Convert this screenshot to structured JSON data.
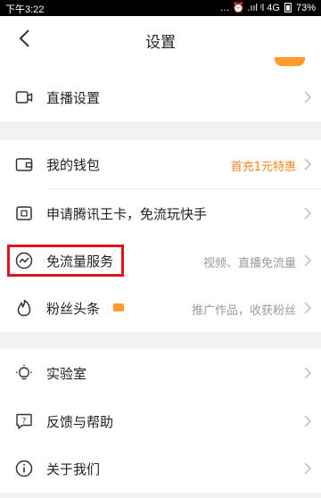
{
  "status_bar": {
    "time": "下午3:22",
    "indicators": "… ⏰ .ııl ᵎl 4G",
    "battery": "73%"
  },
  "nav": {
    "title": "设置"
  },
  "sections": [
    {
      "items": [
        {
          "id": "live",
          "label": "直播设置",
          "value": "",
          "icon": "video-camera-icon"
        }
      ]
    },
    {
      "items": [
        {
          "id": "wallet",
          "label": "我的钱包",
          "value": "首充1元特惠",
          "value_color": "#ff7f1f",
          "icon": "wallet-icon"
        },
        {
          "id": "tencent_card",
          "label": "申请腾讯王卡，免流玩快手",
          "value": "",
          "icon": "sim-card-icon"
        },
        {
          "id": "free_data",
          "label": "免流量服务",
          "value": "视频、直播免流量",
          "icon": "trend-line-icon",
          "highlighted": true
        },
        {
          "id": "fans_headline",
          "label": "粉丝头条",
          "value": "推广作品，收获粉丝",
          "icon": "flame-icon",
          "badge": true
        }
      ]
    },
    {
      "items": [
        {
          "id": "lab",
          "label": "实验室",
          "value": "",
          "icon": "lightbulb-icon"
        },
        {
          "id": "feedback",
          "label": "反馈与帮助",
          "value": "",
          "icon": "help-icon"
        },
        {
          "id": "about",
          "label": "关于我们",
          "value": "",
          "icon": "info-icon"
        }
      ]
    }
  ],
  "colors": {
    "accent": "#ff7f1f",
    "highlight_border": "#e0141b",
    "section_gap": "#f2f2f2"
  }
}
